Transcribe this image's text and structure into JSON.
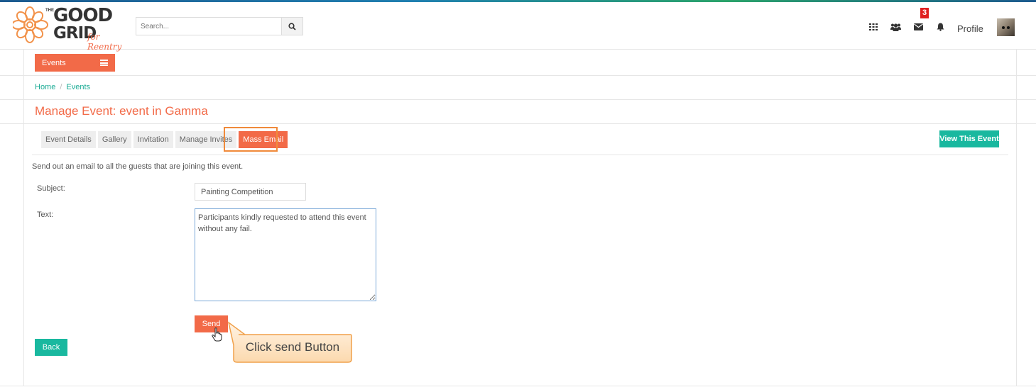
{
  "header": {
    "logo": {
      "the": "THE",
      "good": "GOOD",
      "grid": "GRID",
      "sub": "for Reentry"
    },
    "search": {
      "placeholder": "Search..."
    },
    "mail_badge": "3",
    "profile_label": "Profile",
    "icons": [
      "apps-grid-icon",
      "users-icon",
      "mail-icon",
      "bell-icon"
    ]
  },
  "nav": {
    "events_button": "Events"
  },
  "breadcrumb": {
    "home": "Home",
    "separator": "/",
    "current": "Events"
  },
  "page": {
    "title": "Manage Event: event in Gamma"
  },
  "tabs": [
    {
      "label": "Event Details",
      "active": false
    },
    {
      "label": "Gallery",
      "active": false
    },
    {
      "label": "Invitation",
      "active": false
    },
    {
      "label": "Manage Invites",
      "active": false
    },
    {
      "label": "Mass Email",
      "active": true
    }
  ],
  "view_event_button": "View This Event",
  "form": {
    "description": "Send out an email to all the guests that are joining this event.",
    "subject_label": "Subject:",
    "subject_value": "Painting Competition",
    "text_label": "Text:",
    "text_value": "Participants kindly requested to attend this event without any fail.",
    "send_button": "Send",
    "back_button": "Back"
  },
  "callout": {
    "text": "Click send Button"
  },
  "colors": {
    "accent": "#f26a48",
    "teal": "#19b89f",
    "link": "#1aab94",
    "highlight": "#f08a3a"
  }
}
